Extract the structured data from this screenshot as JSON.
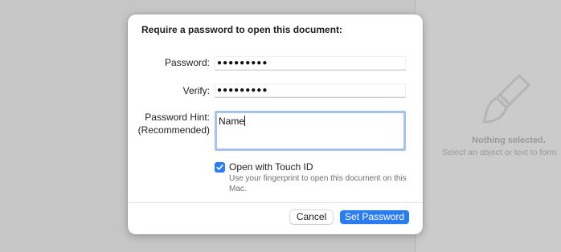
{
  "background": {
    "inspector": {
      "empty_icon": "paintbrush-icon",
      "empty_title": "Nothing selected.",
      "empty_subtitle": "Select an object or text to form"
    }
  },
  "dialog": {
    "title": "Require a password to open this document:",
    "fields": {
      "password_label": "Password:",
      "password_value": "●●●●●●●●●",
      "verify_label": "Verify:",
      "verify_value": "●●●●●●●●●",
      "hint_label_line1": "Password Hint:",
      "hint_label_line2": "(Recommended)",
      "hint_value": "Name"
    },
    "touch_id": {
      "checked": true,
      "label": "Open with Touch ID",
      "help": "Use your fingerprint to open this document on this Mac."
    },
    "buttons": {
      "cancel": "Cancel",
      "set_password": "Set Password"
    }
  },
  "colors": {
    "accent": "#2a7cf2",
    "focus_ring": "#a6c3f2"
  }
}
